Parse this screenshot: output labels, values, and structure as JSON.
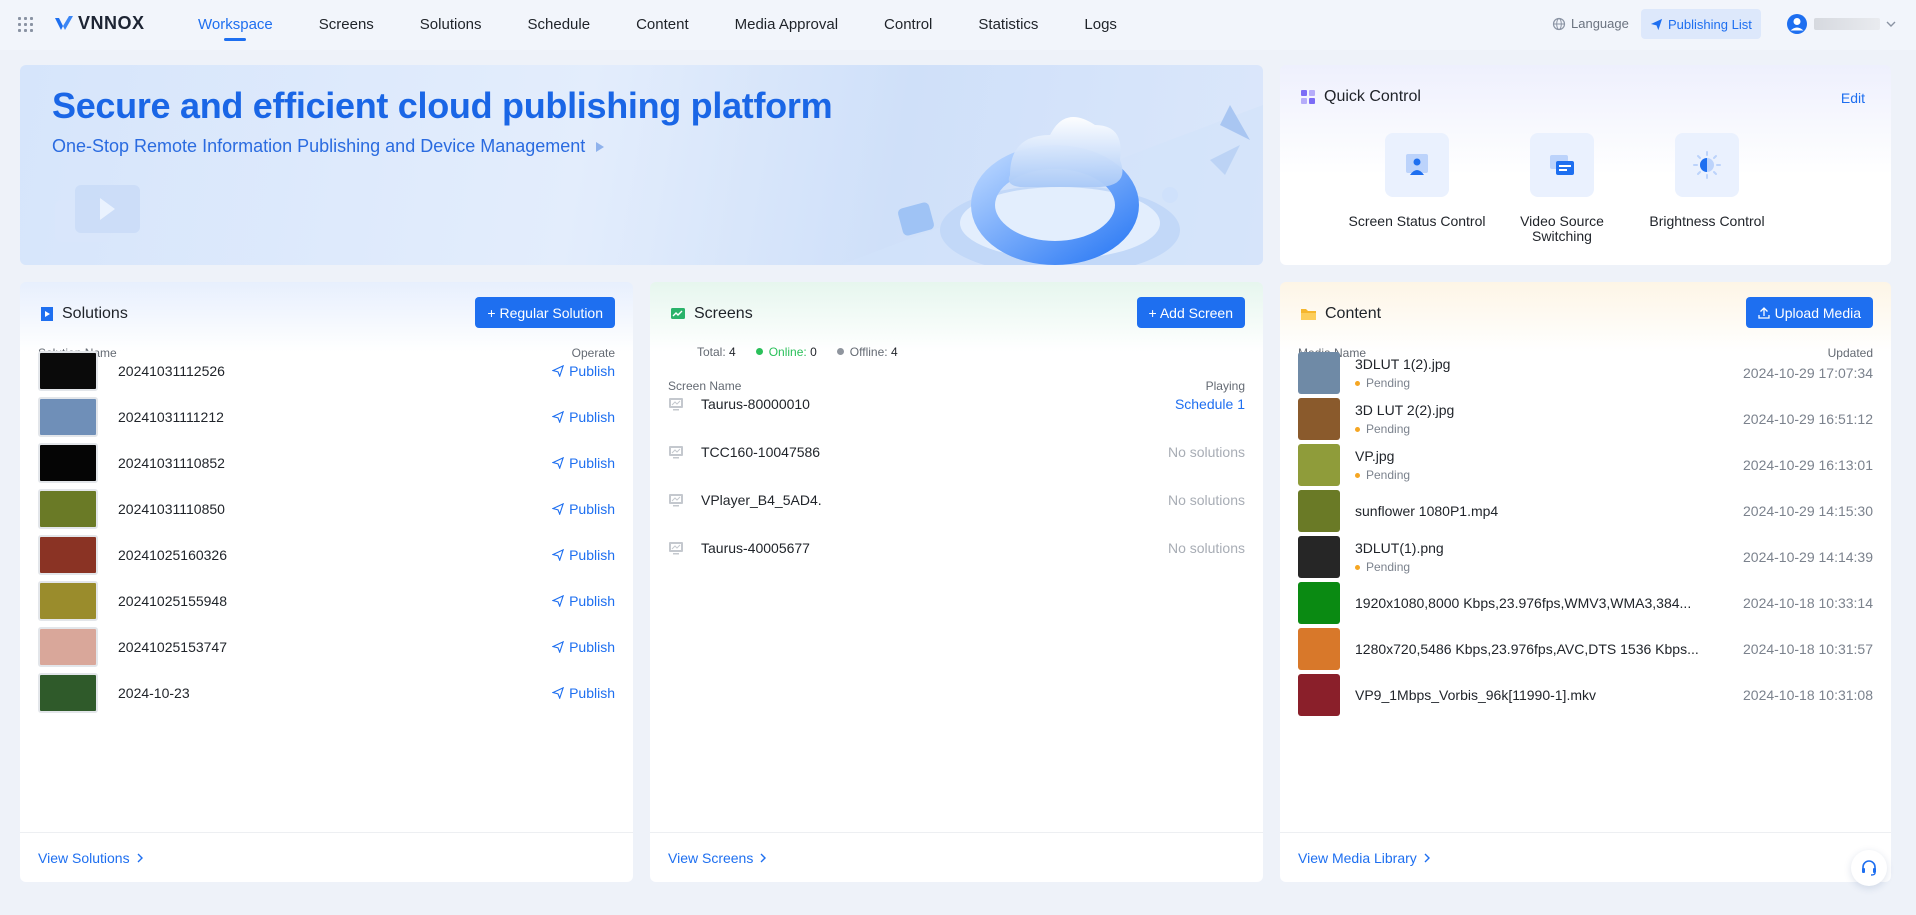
{
  "brand": {
    "name": "VNNOX"
  },
  "nav": {
    "items": [
      "Workspace",
      "Screens",
      "Solutions",
      "Schedule",
      "Content",
      "Media Approval",
      "Control",
      "Statistics",
      "Logs"
    ],
    "active": "Workspace"
  },
  "header": {
    "language": "Language",
    "publishing_list": "Publishing List"
  },
  "banner": {
    "title": "Secure and efficient cloud publishing platform",
    "subtitle": "One-Stop Remote Information Publishing and Device Management"
  },
  "quick_control": {
    "title": "Quick Control",
    "edit": "Edit",
    "items": [
      {
        "label": "Screen Status Control",
        "icon": "screen-status-icon"
      },
      {
        "label": "Video Source Switching",
        "icon": "video-source-icon"
      },
      {
        "label": "Brightness Control",
        "icon": "brightness-icon"
      }
    ]
  },
  "solutions": {
    "title": "Solutions",
    "add_button": "+ Regular Solution",
    "columns": [
      "Solution Name",
      "Operate"
    ],
    "action_label": "Publish",
    "rows": [
      {
        "name": "20241031112526",
        "thumb": "#0a0a0a"
      },
      {
        "name": "20241031111212",
        "thumb": "#6f8fb8"
      },
      {
        "name": "20241031110852",
        "thumb": "#050505"
      },
      {
        "name": "20241031110850",
        "thumb": "#6a7a26"
      },
      {
        "name": "20241025160326",
        "thumb": "#8a3324"
      },
      {
        "name": "20241025155948",
        "thumb": "#9a8c2c"
      },
      {
        "name": "20241025153747",
        "thumb": "#d9a79a"
      },
      {
        "name": "2024-10-23",
        "thumb": "#2f5a2a"
      }
    ],
    "footer": "View Solutions"
  },
  "screens": {
    "title": "Screens",
    "add_button": "+ Add Screen",
    "stats": {
      "total_label": "Total:",
      "total": "4",
      "online_label": "Online:",
      "online": "0",
      "offline_label": "Offline:",
      "offline": "4"
    },
    "columns": [
      "Screen Name",
      "Playing"
    ],
    "rows": [
      {
        "name": "Taurus-80000010",
        "playing": "Schedule 1"
      },
      {
        "name": "TCC160-10047586",
        "playing": "No solutions"
      },
      {
        "name": "VPlayer_B4_5AD4.",
        "playing": "No solutions"
      },
      {
        "name": "Taurus-40005677",
        "playing": "No solutions"
      }
    ],
    "footer": "View Screens"
  },
  "content": {
    "title": "Content",
    "add_button": "Upload Media",
    "columns": [
      "Media Name",
      "Updated"
    ],
    "rows": [
      {
        "name": "3DLUT 1(2).jpg",
        "status": "Pending",
        "date": "2024-10-29 17:07:34",
        "thumb": "#6f8aa6"
      },
      {
        "name": "3D LUT 2(2).jpg",
        "status": "Pending",
        "date": "2024-10-29 16:51:12",
        "thumb": "#8a5a2c"
      },
      {
        "name": "VP.jpg",
        "status": "Pending",
        "date": "2024-10-29 16:13:01",
        "thumb": "#8f9c3a"
      },
      {
        "name": "sunflower 1080P1.mp4",
        "status": "",
        "date": "2024-10-29 14:15:30",
        "thumb": "#6a7a26"
      },
      {
        "name": "3DLUT(1).png",
        "status": "Pending",
        "date": "2024-10-29 14:14:39",
        "thumb": "#262626"
      },
      {
        "name": "1920x1080,8000 Kbps,23.976fps,WMV3,WMA3,384...",
        "status": "",
        "date": "2024-10-18 10:33:14",
        "thumb": "#0a8a12"
      },
      {
        "name": "1280x720,5486 Kbps,23.976fps,AVC,DTS 1536 Kbps...",
        "status": "",
        "date": "2024-10-18 10:31:57",
        "thumb": "#d8782a"
      },
      {
        "name": "VP9_1Mbps_Vorbis_96k[11990-1].mkv",
        "status": "",
        "date": "2024-10-18 10:31:08",
        "thumb": "#8a1f2a"
      }
    ],
    "footer": "View Media Library"
  },
  "colors": {
    "accent": "#1e6ff0",
    "online": "#2ac05a",
    "offline": "#8f959e",
    "pending": "#f5a623"
  }
}
